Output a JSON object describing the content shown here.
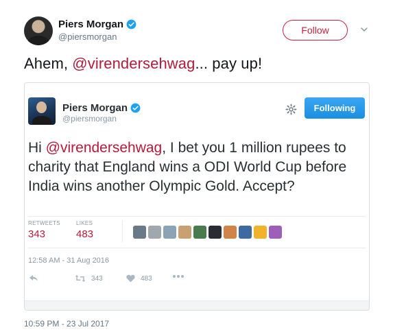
{
  "author": {
    "name": "Piers Morgan",
    "handle": "@piersmorgan",
    "follow_label": "Follow"
  },
  "tweet": {
    "text_prefix": "Ahem, ",
    "mention": "@virendersehwag",
    "text_suffix": "... pay up!",
    "timestamp": "10:59 PM - 23 Jul 2017"
  },
  "quoted": {
    "name": "Piers Morgan",
    "handle": "@piersmorgan",
    "following_label": "Following",
    "text_prefix": "Hi ",
    "mention": "@virendersehwag",
    "text_suffix": ", I bet you 1 million rupees to charity that England wins a ODI World Cup before India wins another Olympic Gold. Accept?",
    "retweets_label": "RETWEETS",
    "retweets_count": "343",
    "likes_label": "LIKES",
    "likes_count": "483",
    "timestamp": "12:58 AM - 31 Aug 2016",
    "action_retweet_count": "343",
    "action_like_count": "483",
    "liker_colors": [
      "#6b7a88",
      "#a0a7ad",
      "#8aa3b5",
      "#c8a071",
      "#4a7b4f",
      "#2b2b33",
      "#d1844a",
      "#3e6aa0",
      "#f1b32c",
      "#9d5fb8"
    ]
  },
  "colors": {
    "accent": "#b31b3a",
    "verified": "#1da1f2",
    "following_button": "#1b8fe0"
  }
}
